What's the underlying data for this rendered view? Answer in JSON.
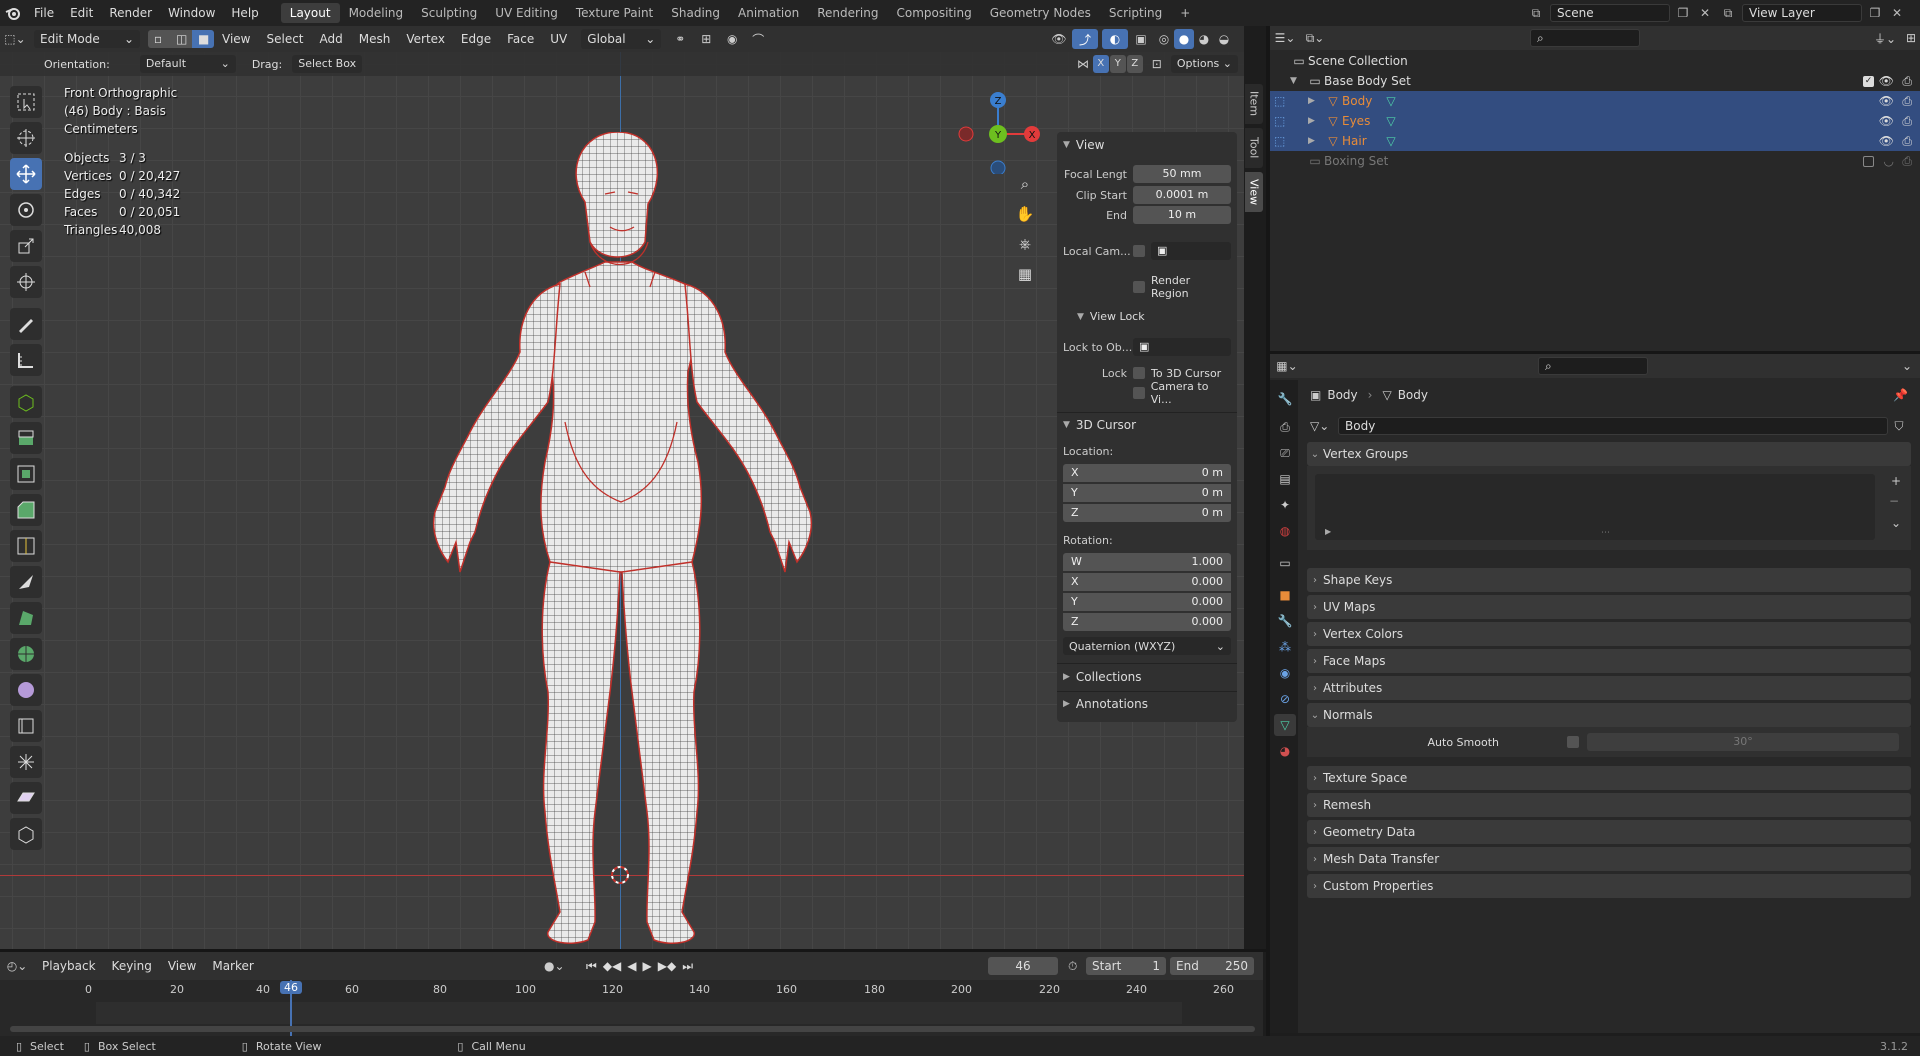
{
  "app": {
    "logo": "blender-logo-icon"
  },
  "menubar": {
    "items": [
      "File",
      "Edit",
      "Render",
      "Window",
      "Help"
    ]
  },
  "workspaces": {
    "tabs": [
      "Layout",
      "Modeling",
      "Sculpting",
      "UV Editing",
      "Texture Paint",
      "Shading",
      "Animation",
      "Rendering",
      "Compositing",
      "Geometry Nodes",
      "Scripting"
    ],
    "active": "Layout",
    "add": "+"
  },
  "scene": {
    "label": "Scene",
    "view_layer": "View Layer"
  },
  "viewport_header": {
    "mode": "Edit Mode",
    "menus": [
      "View",
      "Select",
      "Add",
      "Mesh",
      "Vertex",
      "Edge",
      "Face",
      "UV"
    ],
    "transform": "Global"
  },
  "tool_settings": {
    "orientation_label": "Orientation:",
    "orientation_value": "Default",
    "drag_label": "Drag:",
    "drag_value": "Select Box",
    "axis_x": "X",
    "axis_y": "Y",
    "axis_z": "Z",
    "options": "Options"
  },
  "overlay": {
    "view_name": "Front Orthographic",
    "object_info": "(46) Body : Basis",
    "units": "Centimeters",
    "stats": [
      {
        "label": "Objects",
        "value": "3 / 3"
      },
      {
        "label": "Vertices",
        "value": "0 / 20,427"
      },
      {
        "label": "Edges",
        "value": "0 / 40,342"
      },
      {
        "label": "Faces",
        "value": "0 / 20,051"
      },
      {
        "label": "Triangles",
        "value": "40,008"
      }
    ]
  },
  "gizmo": {
    "x": "X",
    "y": "Y",
    "z": "Z"
  },
  "npanel": {
    "tabs": [
      "Item",
      "Tool",
      "View"
    ],
    "view_title": "View",
    "focal_label": "Focal Lengt",
    "focal_value": "50 mm",
    "clip_start_label": "Clip Start",
    "clip_start_value": "0.0001 m",
    "clip_end_label": "End",
    "clip_end_value": "10 m",
    "local_cam_label": "Local Cam...",
    "render_region": "Render Region",
    "view_lock_title": "View Lock",
    "lock_obj_label": "Lock to Ob...",
    "lock_label": "Lock",
    "to_cursor": "To 3D Cursor",
    "camera_to_view": "Camera to Vi...",
    "cursor_title": "3D Cursor",
    "location_label": "Location:",
    "loc": [
      {
        "axis": "X",
        "value": "0 m"
      },
      {
        "axis": "Y",
        "value": "0 m"
      },
      {
        "axis": "Z",
        "value": "0 m"
      }
    ],
    "rotation_label": "Rotation:",
    "rot": [
      {
        "axis": "W",
        "value": "1.000"
      },
      {
        "axis": "X",
        "value": "0.000"
      },
      {
        "axis": "Y",
        "value": "0.000"
      },
      {
        "axis": "Z",
        "value": "0.000"
      }
    ],
    "rotation_mode": "Quaternion (WXYZ)",
    "collections": "Collections",
    "annotations": "Annotations"
  },
  "outliner": {
    "root": "Scene Collection",
    "items": [
      {
        "name": "Base Body Set",
        "level": 1
      },
      {
        "name": "Body",
        "level": 2
      },
      {
        "name": "Eyes",
        "level": 2
      },
      {
        "name": "Hair",
        "level": 2
      },
      {
        "name": "Boxing Set",
        "level": 1
      }
    ]
  },
  "properties": {
    "breadcrumb_object": "Body",
    "breadcrumb_mesh": "Body",
    "datablock": "Body",
    "panels": [
      "Vertex Groups",
      "Shape Keys",
      "UV Maps",
      "Vertex Colors",
      "Face Maps",
      "Attributes",
      "Normals",
      "Texture Space",
      "Remesh",
      "Geometry Data",
      "Mesh Data Transfer",
      "Custom Properties"
    ],
    "auto_smooth_label": "Auto Smooth",
    "auto_smooth_angle": "30°"
  },
  "timeline": {
    "menus": [
      "Playback",
      "Keying",
      "View",
      "Marker"
    ],
    "current_frame": "46",
    "start_label": "Start",
    "start_value": "1",
    "end_label": "End",
    "end_value": "250",
    "ruler": [
      "0",
      "20",
      "40",
      "46",
      "60",
      "80",
      "100",
      "120",
      "140",
      "160",
      "180",
      "200",
      "220",
      "240",
      "260"
    ]
  },
  "statusbar": {
    "select": "Select",
    "box_select": "Box Select",
    "rotate": "Rotate View",
    "call_menu": "Call Menu",
    "version": "3.1.2"
  },
  "colors": {
    "accent": "#4772b3",
    "selected_row": "#334d80",
    "object_orange": "#e88c39",
    "edge_red": "#c0302a",
    "axis_x": "#e23b3b",
    "axis_y": "#6dbf1f",
    "axis_z": "#3a7ecf"
  }
}
